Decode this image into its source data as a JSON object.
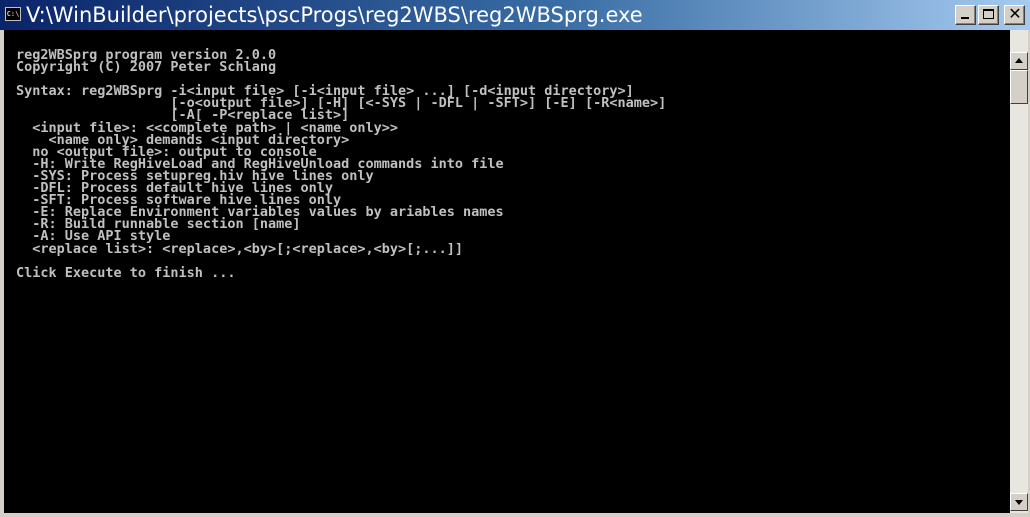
{
  "window": {
    "title": "V:\\WinBuilder\\projects\\pscProgs\\reg2WBS\\reg2WBSprg.exe",
    "icon_name": "console-app-icon",
    "icon_glyph": "C:\\",
    "buttons": {
      "minimize_icon": "minimize-icon",
      "maximize_icon": "maximize-icon",
      "close_icon": "close-icon",
      "close_glyph": "✕"
    }
  },
  "console": {
    "text_color": "#c0c0c0",
    "background_color": "#000000",
    "lines": [
      "reg2WBSprg program version 2.0.0",
      "Copyright (C) 2007 Peter Schlang",
      "",
      "Syntax: reg2WBSprg -i<input file> [-i<input file> ...] [-d<input directory>]",
      "                   [-o<output file>] [-H] [<-SYS | -DFL | -SFT>] [-E] [-R<name>]",
      "                   [-A[ -P<replace list>]",
      "  <input file>: <<complete path> | <name only>>",
      "    <name only> demands <input directory>",
      "  no <output file>: output to console",
      "  -H: Write RegHiveLoad and RegHiveUnload commands into file",
      "  -SYS: Process setupreg.hiv hive lines only",
      "  -DFL: Process default hive lines only",
      "  -SFT: Process software hive lines only",
      "  -E: Replace Environment variables values by ariables names",
      "  -R: Build runnable section [name]",
      "  -A: Use API style",
      "  <replace list>: <replace>,<by>[;<replace>,<by>[;...]]",
      "",
      "Click Execute to finish ..."
    ]
  },
  "scrollbar": {
    "up_icon": "scroll-up-arrow-icon",
    "down_icon": "scroll-down-arrow-icon",
    "position": 0.0
  },
  "colors": {
    "titlebar_active_start": "#0a246a",
    "titlebar_active_end": "#a6caf0",
    "chrome": "#d4d0c8"
  }
}
